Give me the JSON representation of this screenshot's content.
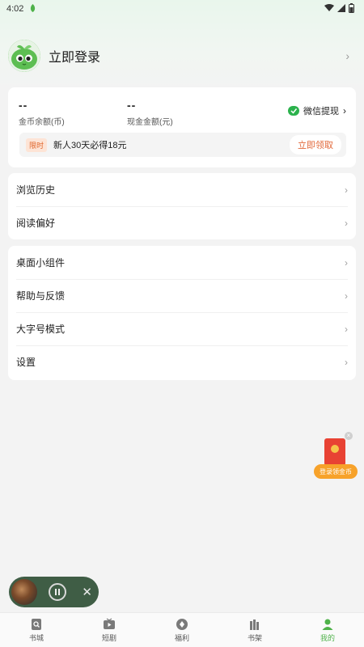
{
  "status_bar": {
    "time": "4:02"
  },
  "profile": {
    "login_text": "立即登录"
  },
  "wallet": {
    "coin_balance_value": "--",
    "coin_balance_label": "金币余额(币)",
    "cash_balance_value": "--",
    "cash_balance_label": "现金金额(元)",
    "wechat_withdraw_label": "微信提现",
    "promo_tag": "限时",
    "promo_text": "新人30天必得18元",
    "claim_label": "立即领取"
  },
  "menu_group_1": [
    {
      "label": "浏览历史"
    },
    {
      "label": "阅读偏好"
    }
  ],
  "menu_group_2": [
    {
      "label": "桌面小组件"
    },
    {
      "label": "帮助与反馈"
    },
    {
      "label": "大字号模式"
    },
    {
      "label": "设置"
    }
  ],
  "red_envelope": {
    "label": "登录领金币"
  },
  "bottom_nav": [
    {
      "label": "书城",
      "icon": "search-book-icon"
    },
    {
      "label": "短剧",
      "icon": "tv-play-icon"
    },
    {
      "label": "福利",
      "icon": "gift-diamond-icon"
    },
    {
      "label": "书架",
      "icon": "bookshelf-icon"
    },
    {
      "label": "我的",
      "icon": "person-icon",
      "active": true
    }
  ],
  "colors": {
    "accent_green": "#4fb24a",
    "promo_orange": "#e2683a",
    "envelope_red": "#e84233",
    "pill_orange": "#f7a22a",
    "player_bg": "#3f5d45"
  }
}
